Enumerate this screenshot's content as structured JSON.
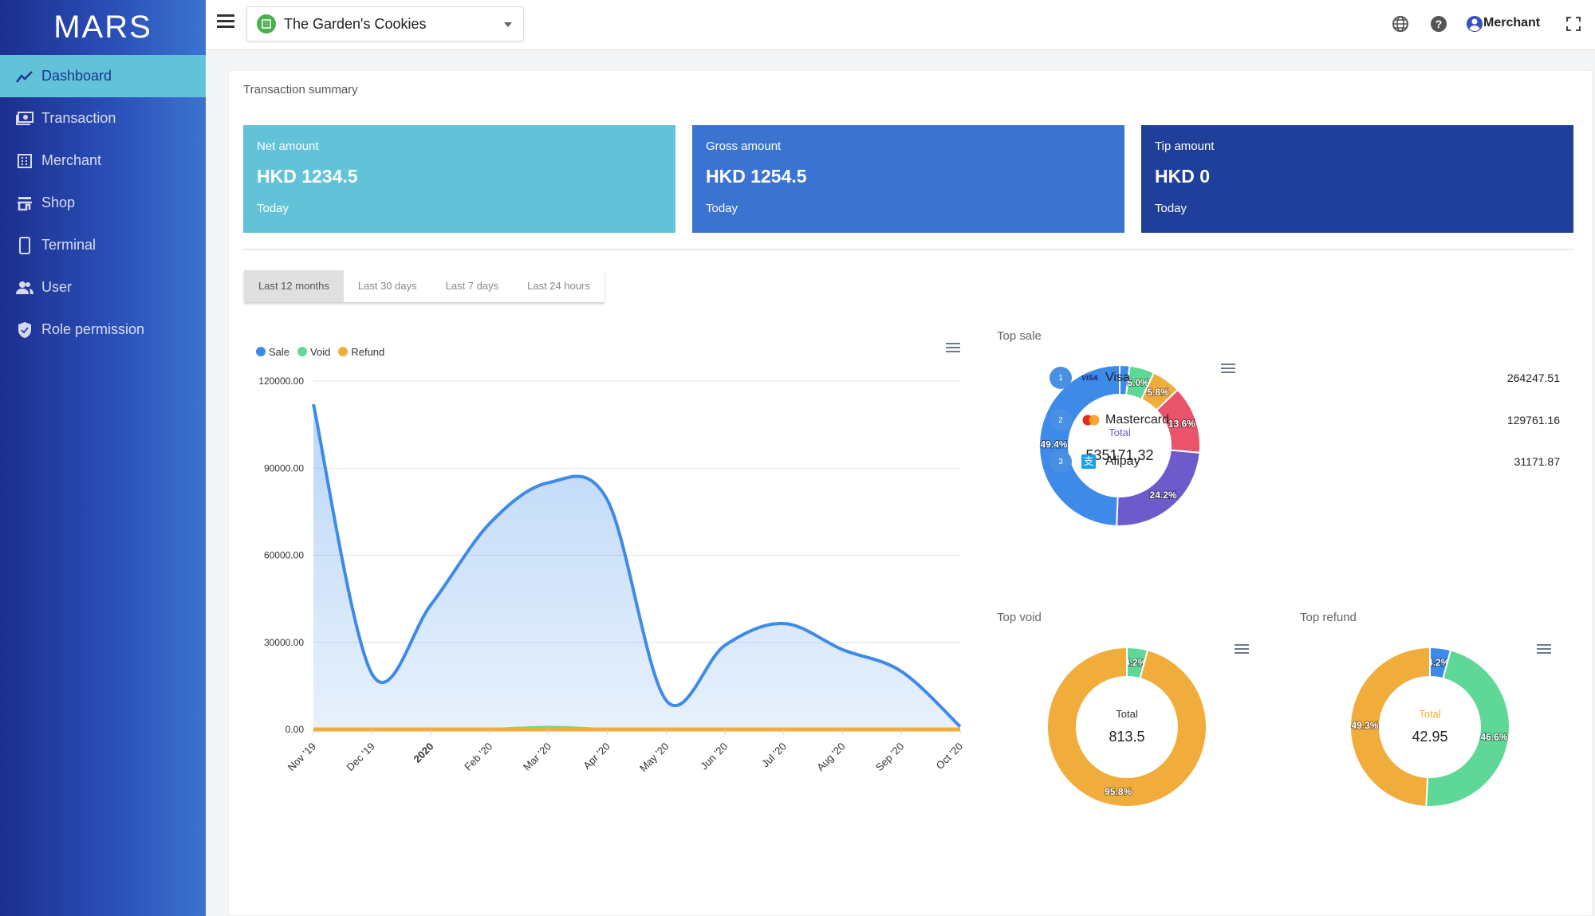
{
  "app": {
    "logo": "MARS"
  },
  "sidebar": {
    "items": [
      {
        "label": "Dashboard",
        "icon": "chart-line-icon",
        "active": true
      },
      {
        "label": "Transaction",
        "icon": "money-icon"
      },
      {
        "label": "Merchant",
        "icon": "building-icon"
      },
      {
        "label": "Shop",
        "icon": "store-icon"
      },
      {
        "label": "Terminal",
        "icon": "phone-icon"
      },
      {
        "label": "User",
        "icon": "users-icon"
      },
      {
        "label": "Role permission",
        "icon": "shield-icon"
      }
    ]
  },
  "topbar": {
    "shop": "The Garden's Cookies",
    "user": "Merchant"
  },
  "summary": {
    "title": "Transaction summary",
    "cards": [
      {
        "label": "Net amount",
        "value": "HKD 1234.5",
        "period": "Today",
        "color": "#62c3d8"
      },
      {
        "label": "Gross amount",
        "value": "HKD 1254.5",
        "period": "Today",
        "color": "#3b74d0"
      },
      {
        "label": "Tip amount",
        "value": "HKD 0",
        "period": "Today",
        "color": "#1f3f9a"
      }
    ],
    "tabs": [
      "Last 12 months",
      "Last 30 days",
      "Last 7 days",
      "Last 24 hours"
    ],
    "active_tab": 0
  },
  "chart_data": [
    {
      "type": "area",
      "categories": [
        "Nov '19",
        "Dec '19",
        "2020",
        "Feb '20",
        "Mar '20",
        "Apr '20",
        "May '20",
        "Jun '20",
        "Jul '20",
        "Aug '20",
        "Sep '20",
        "Oct '20"
      ],
      "ylim": [
        0,
        120000
      ],
      "yticks": [
        "0.00",
        "30000.00",
        "60000.00",
        "90000.00",
        "120000.00"
      ],
      "grid": true,
      "legend": "top-left",
      "series": [
        {
          "name": "Sale",
          "color": "#3d8ae8",
          "values": [
            112000,
            19000,
            43000,
            71000,
            85000,
            79000,
            10000,
            29000,
            36500,
            27500,
            20000,
            1000
          ]
        },
        {
          "name": "Void",
          "color": "#5fd897",
          "values": [
            0,
            0,
            0,
            0,
            700,
            0,
            0,
            0,
            0,
            0,
            0,
            0
          ]
        },
        {
          "name": "Refund",
          "color": "#f0ad3c",
          "values": [
            0,
            0,
            0,
            0,
            0,
            0,
            0,
            0,
            0,
            0,
            0,
            0
          ]
        }
      ]
    },
    {
      "type": "pie",
      "title": "Top sale",
      "center_label": "Total",
      "total": "535171.32",
      "center_color": "#6a5acd",
      "slices": [
        {
          "value": 2.0,
          "label": "",
          "color": "#3d8ae8"
        },
        {
          "value": 5.0,
          "label": "5.0%",
          "color": "#5fd897"
        },
        {
          "value": 5.8,
          "label": "5.8%",
          "color": "#f0ad3c"
        },
        {
          "value": 13.6,
          "label": "13.6%",
          "color": "#e9546b"
        },
        {
          "value": 24.2,
          "label": "24.2%",
          "color": "#6d5acb"
        },
        {
          "value": 49.4,
          "label": "49.4%",
          "color": "#3d8ae8"
        }
      ]
    },
    {
      "type": "pie",
      "title": "Top void",
      "center_label": "Total",
      "total": "813.5",
      "center_color": "#333333",
      "slices": [
        {
          "value": 4.2,
          "label": "4.2%",
          "color": "#5fd897"
        },
        {
          "value": 95.8,
          "label": "95.8%",
          "color": "#f0ad3c"
        }
      ]
    },
    {
      "type": "pie",
      "title": "Top refund",
      "center_label": "Total",
      "total": "42.95",
      "center_color": "#f0ad3c",
      "slices": [
        {
          "value": 4.2,
          "label": "4.2%",
          "color": "#3d8ae8"
        },
        {
          "value": 46.6,
          "label": "46.6%",
          "color": "#5fd897"
        },
        {
          "value": 49.3,
          "label": "49.3%",
          "color": "#f0ad3c"
        }
      ]
    }
  ],
  "top_sale_list": [
    {
      "rank": "1",
      "name": "Visa",
      "value": "264247.51",
      "icon": "visa-icon",
      "logo_text": "VISA"
    },
    {
      "rank": "2",
      "name": "Mastercard",
      "value": "129761.16",
      "icon": "mastercard-icon"
    },
    {
      "rank": "3",
      "name": "Alipay",
      "value": "31171.87",
      "icon": "alipay-icon",
      "logo_text": "支"
    }
  ]
}
